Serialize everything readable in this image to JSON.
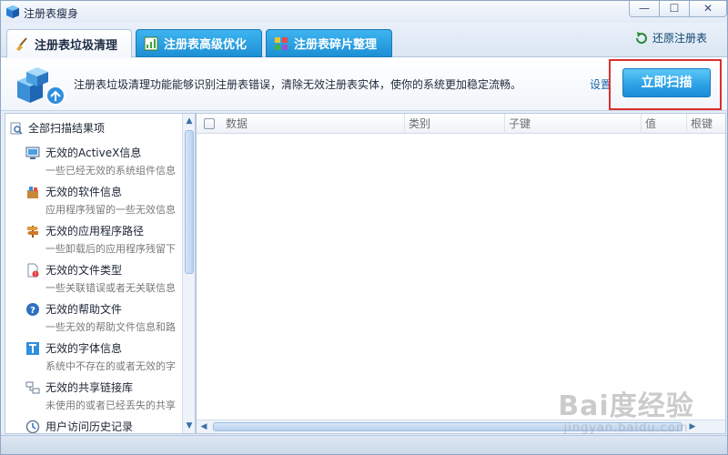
{
  "window": {
    "title": "注册表瘦身",
    "controls": {
      "minimize": "—",
      "maximize": "☐",
      "close": "✕"
    }
  },
  "tabs": [
    {
      "label": "注册表垃圾清理",
      "active": true,
      "icon": "broom-icon"
    },
    {
      "label": "注册表高级优化",
      "active": false,
      "icon": "chart-icon"
    },
    {
      "label": "注册表碎片整理",
      "active": false,
      "icon": "defrag-icon"
    }
  ],
  "restore": {
    "label": "还原注册表",
    "icon": "restore-icon"
  },
  "banner": {
    "description": "注册表垃圾清理功能能够识别注册表错误，清除无效注册表实体，使你的系统更加稳定流畅。",
    "settings_label": "设置",
    "scan_label": "立即扫描",
    "icon": "registry-cubes-icon"
  },
  "left_pane": {
    "header": "全部扫描结果项",
    "header_icon": "search-icon",
    "items": [
      {
        "title": "无效的ActiveX信息",
        "desc": "一些已经无效的系统组件信息",
        "icon": "monitor-icon"
      },
      {
        "title": "无效的软件信息",
        "desc": "应用程序残留的一些无效信息",
        "icon": "software-box-icon"
      },
      {
        "title": "无效的应用程序路径",
        "desc": "一些卸载后的应用程序残留下",
        "icon": "signpost-icon"
      },
      {
        "title": "无效的文件类型",
        "desc": "一些关联错误或者无关联信息",
        "icon": "file-error-icon"
      },
      {
        "title": "无效的帮助文件",
        "desc": "一些无效的帮助文件信息和路",
        "icon": "help-icon"
      },
      {
        "title": "无效的字体信息",
        "desc": "系统中不存在的或者无效的字",
        "icon": "font-icon"
      },
      {
        "title": "无效的共享链接库",
        "desc": "未使用的或者已经丢失的共享",
        "icon": "link-library-icon"
      },
      {
        "title": "用户访问历史记录",
        "desc": "",
        "icon": "history-icon"
      }
    ]
  },
  "table": {
    "columns": [
      "数据",
      "类别",
      "子键",
      "值",
      "根键"
    ],
    "rows": []
  },
  "watermark": {
    "logo": "Bai度经验",
    "url": "jingyan.baidu.com"
  },
  "colors": {
    "accent": "#2ea3e6",
    "highlight": "#d93030",
    "tab_inactive": "#1d8fd4"
  }
}
